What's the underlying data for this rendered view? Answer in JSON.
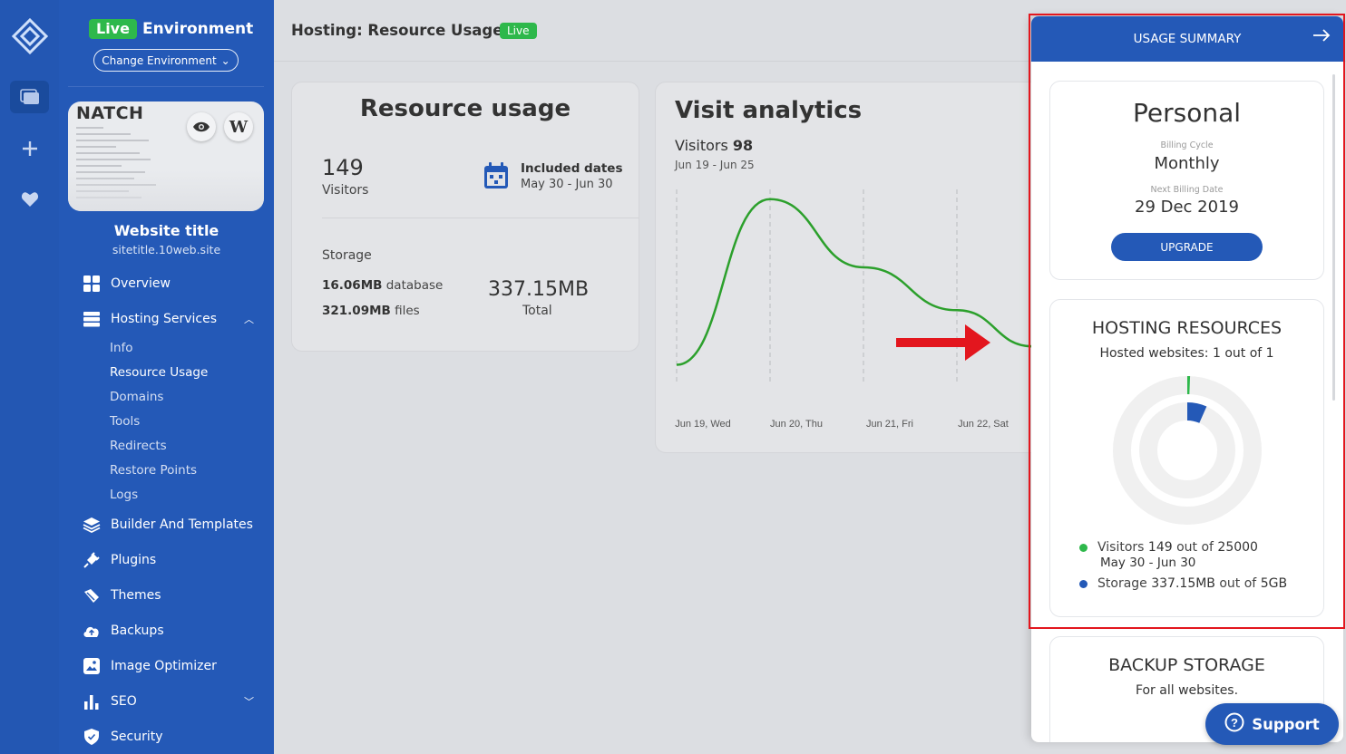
{
  "environment": {
    "badge": "Live",
    "label": "Environment",
    "change_label": "Change Environment"
  },
  "site": {
    "thumbnail_title": "NATCH",
    "title": "Website title",
    "url": "sitetitle.10web.site"
  },
  "sidebar": {
    "items": [
      {
        "label": "Overview",
        "icon": "grid-icon"
      },
      {
        "label": "Hosting Services",
        "icon": "server-icon"
      },
      {
        "label": "Builder And Templates",
        "icon": "layers-icon"
      },
      {
        "label": "Plugins",
        "icon": "plug-icon"
      },
      {
        "label": "Themes",
        "icon": "brush-icon"
      },
      {
        "label": "Backups",
        "icon": "cloud-upload-icon"
      },
      {
        "label": "Image Optimizer",
        "icon": "image-icon"
      },
      {
        "label": "SEO",
        "icon": "bar-chart-icon"
      },
      {
        "label": "Security",
        "icon": "shield-icon"
      }
    ],
    "sub_items": [
      "Info",
      "Resource Usage",
      "Domains",
      "Tools",
      "Redirects",
      "Restore Points",
      "Logs"
    ]
  },
  "header": {
    "title": "Hosting: Resource Usage",
    "badge": "Live"
  },
  "resource_usage": {
    "title": "Resource usage",
    "visitors_count": "149",
    "visitors_label": "Visitors",
    "dates_label": "Included dates",
    "dates_value": "May 30 - Jun 30",
    "storage_label": "Storage",
    "database_value": "16.06MB",
    "database_label": "database",
    "files_value": "321.09MB",
    "files_label": "files",
    "total_value": "337.15MB",
    "total_label": "Total"
  },
  "visit_analytics": {
    "title": "Visit analytics",
    "visitors_label": "Visitors",
    "visitors_count": "98",
    "range": "Jun 19 - Jun 25"
  },
  "chart_data": {
    "type": "line",
    "categories": [
      "Jun 19, Wed",
      "Jun 20, Thu",
      "Jun 21, Fri",
      "Jun 22, Sat"
    ],
    "series": [
      {
        "values": [
          10,
          95,
          60,
          38
        ]
      }
    ],
    "color": "#2ca02c",
    "grid": "dashed vertical"
  },
  "usage_summary": {
    "header": "USAGE SUMMARY",
    "plan": "Personal",
    "billing_cycle_label": "Billing Cycle",
    "billing_cycle": "Monthly",
    "next_billing_label": "Next Billing Date",
    "next_billing": "29 Dec 2019",
    "upgrade_label": "UPGRADE",
    "hosting_title": "HOSTING RESOURCES",
    "hosted_websites": "Hosted websites: 1 out of 1",
    "visitors_prefix": "Visitors",
    "visitors_used": "149",
    "visitors_mid": "out of",
    "visitors_limit": "25000",
    "visitors_dates": "May 30 - Jun 30",
    "visitors_fraction": 0.006,
    "storage_prefix": "Storage",
    "storage_used": "337.15MB",
    "storage_mid": "out of",
    "storage_limit": "5GB",
    "storage_fraction": 0.066,
    "backup_title": "BACKUP STORAGE",
    "backup_sub": "For all websites."
  },
  "support_label": "Support",
  "colors": {
    "brand_blue": "#2459b7",
    "live_green": "#2eb84b",
    "highlight_red": "#e3161e"
  }
}
